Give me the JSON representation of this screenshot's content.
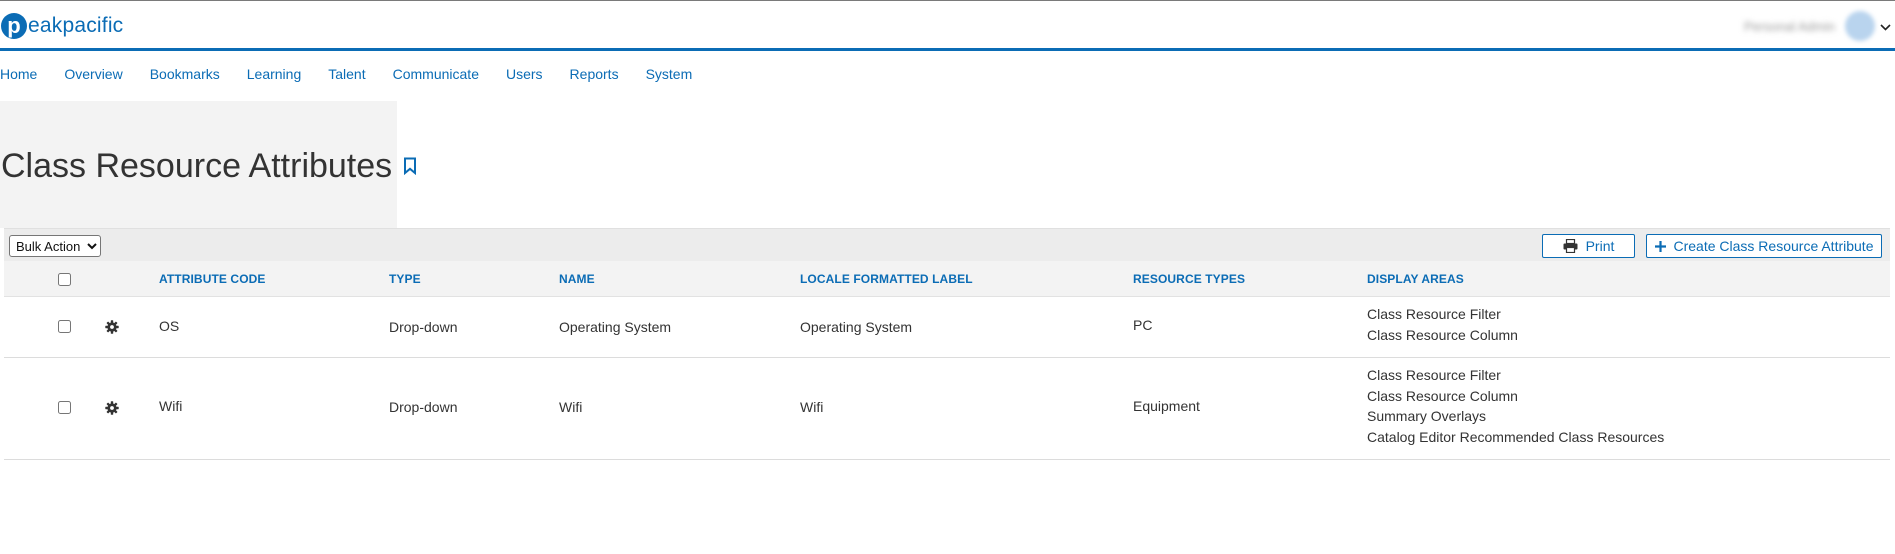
{
  "header": {
    "logo_mark": "p",
    "logo_text": "eakpacific",
    "user_name": "Personal Admin"
  },
  "nav": [
    "Home",
    "Overview",
    "Bookmarks",
    "Learning",
    "Talent",
    "Communicate",
    "Users",
    "Reports",
    "System"
  ],
  "page_title": "Class Resource Attributes",
  "toolbar": {
    "bulk_action": "Bulk Action",
    "print_label": "Print",
    "create_label": "Create Class Resource Attribute"
  },
  "columns": {
    "attribute_code": "ATTRIBUTE CODE",
    "type": "TYPE",
    "name": "NAME",
    "locale_label": "LOCALE FORMATTED LABEL",
    "resource_types": "RESOURCE TYPES",
    "display_areas": "DISPLAY AREAS"
  },
  "rows": [
    {
      "code": "OS",
      "type": "Drop-down",
      "name": "Operating System",
      "label": "Operating System",
      "resource_types": "PC",
      "display_areas": [
        "Class Resource Filter",
        "Class Resource Column"
      ]
    },
    {
      "code": "Wifi",
      "type": "Drop-down",
      "name": "Wifi",
      "label": "Wifi",
      "resource_types": "Equipment",
      "display_areas": [
        "Class Resource Filter",
        "Class Resource Column",
        "Summary Overlays",
        "Catalog Editor Recommended Class Resources"
      ]
    }
  ],
  "colors": {
    "brand": "#0b6cb5",
    "header_bg": "#f3f3f3"
  },
  "icons": [
    "user-caret-icon",
    "bookmark-icon",
    "print-icon",
    "plus-icon",
    "gear-icon"
  ]
}
